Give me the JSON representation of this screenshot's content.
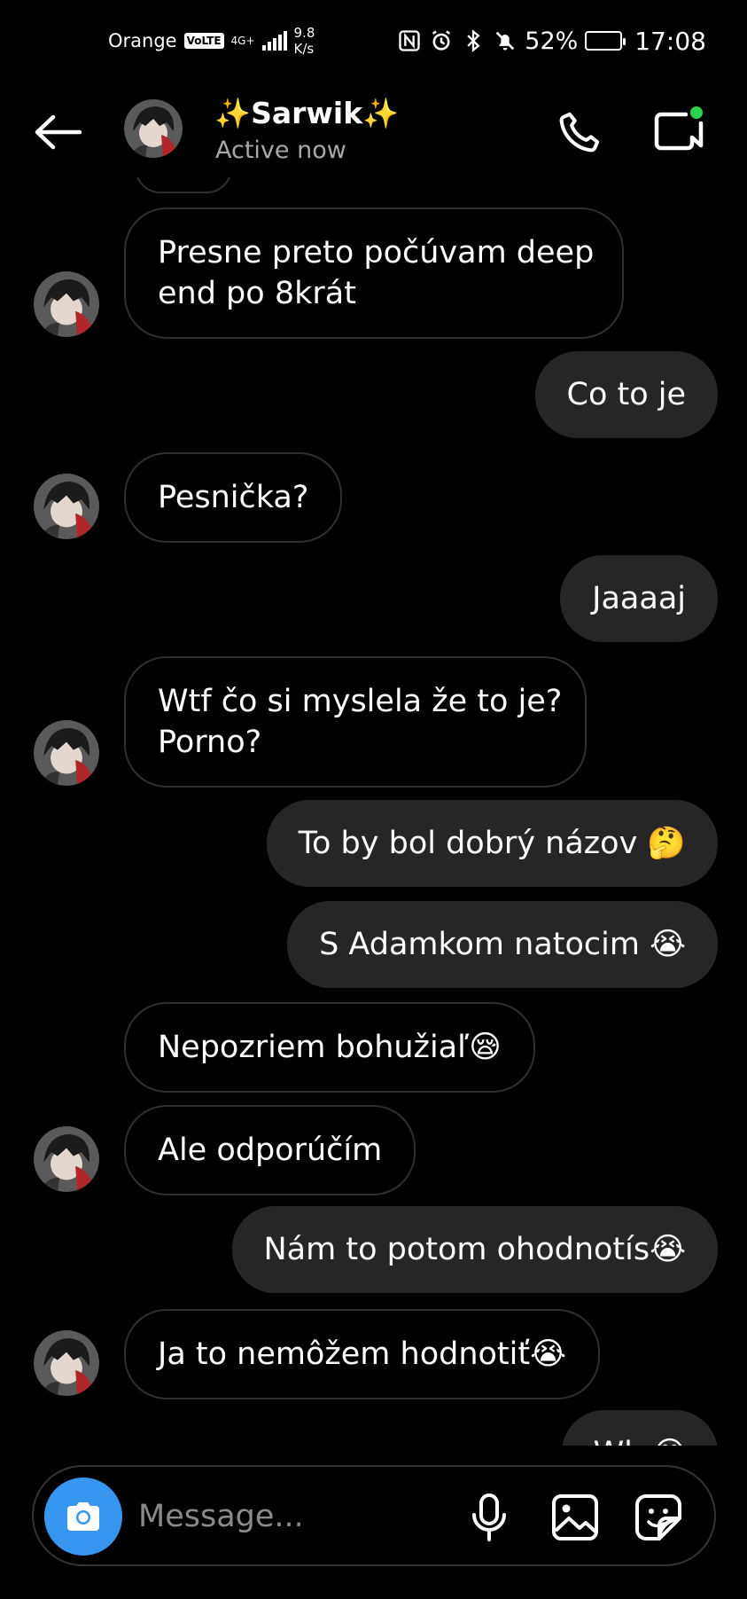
{
  "status_bar": {
    "carrier": "Orange",
    "volte": "VoLTE",
    "network": "4G+",
    "speed_value": "9.8",
    "speed_unit": "K/s",
    "battery_percent": "52%",
    "battery_level": 0.52,
    "time": "17:08"
  },
  "header": {
    "contact_name": "✨Sarwik✨",
    "status": "Active now",
    "icons": [
      "back-arrow-icon",
      "phone-icon",
      "video-call-icon"
    ]
  },
  "messages": [
    {
      "direction": "in",
      "text": "Presne preto počúvam deep",
      "text2": "end po 8krát"
    },
    {
      "direction": "out",
      "text": "Co to je"
    },
    {
      "direction": "in",
      "text": "Pesnička?"
    },
    {
      "direction": "out",
      "text": "Jaaaaj"
    },
    {
      "direction": "in",
      "text": "Wtf čo si myslela že to je?",
      "text2": "Porno?"
    },
    {
      "direction": "out",
      "text": "To by bol dobrý názov 🤔"
    },
    {
      "direction": "out",
      "text": "S Adamkom natocim 😭"
    },
    {
      "direction": "in",
      "text": "Nepozriem bohužiaľ😪"
    },
    {
      "direction": "in",
      "text": "Ale odporúčím"
    },
    {
      "direction": "out",
      "text": "Nám to potom ohodnotís😭"
    },
    {
      "direction": "in",
      "text": "Ja to nemôžem hodnotiť😭"
    },
    {
      "direction": "out",
      "text": "Wh 😊"
    }
  ],
  "composer": {
    "placeholder": "Message...",
    "icons": [
      "camera-icon",
      "microphone-icon",
      "gallery-icon",
      "sticker-icon"
    ]
  },
  "colors": {
    "background": "#000000",
    "outgoing_bubble": "#262626",
    "incoming_border": "#2f2f2f",
    "accent_blue": "#3797f0",
    "online_green": "#2bd34c",
    "secondary_text": "#a8a8a8"
  }
}
